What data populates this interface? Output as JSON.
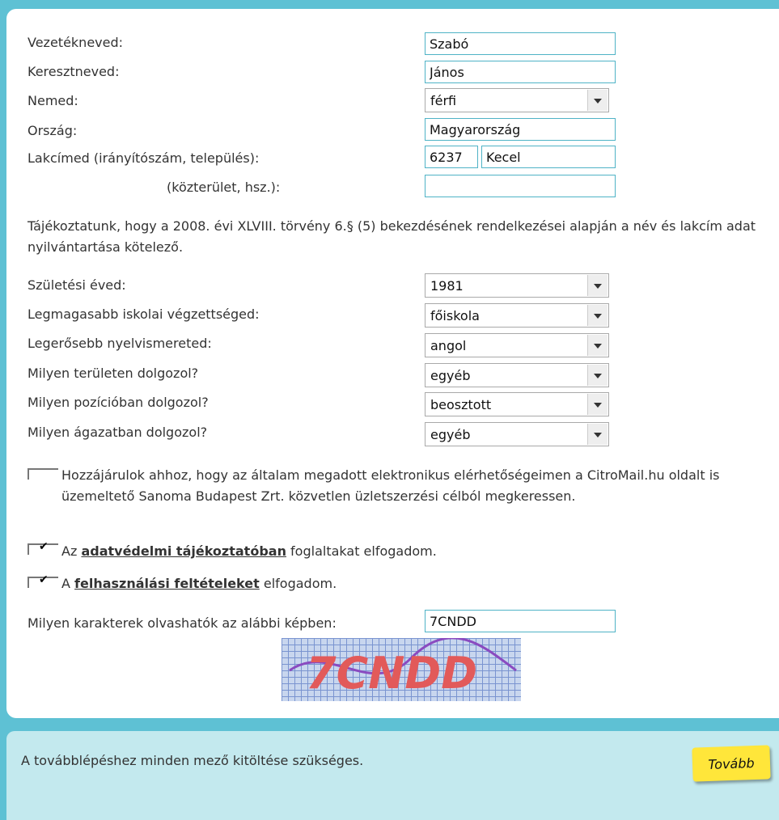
{
  "form": {
    "last_name": {
      "label": "Vezetékneved:",
      "value": "Szabó"
    },
    "first_name": {
      "label": "Keresztneved:",
      "value": "János"
    },
    "gender": {
      "label": "Nemed:",
      "value": "férfi"
    },
    "country": {
      "label": "Ország:",
      "value": "Magyarország"
    },
    "address": {
      "label": "Lakcímed (irányítószám, település):",
      "zip": "6237",
      "city": "Kecel"
    },
    "street": {
      "label": "(közterület, hsz.):",
      "value": ""
    }
  },
  "notice": "Tájékoztatunk, hogy a 2008. évi XLVIII. törvény 6.§ (5) bekezdésének rendelkezései alapján a név és lakcím adat nyilvántartása kötelező.",
  "profile": {
    "birth_year": {
      "label": "Születési éved:",
      "value": "1981"
    },
    "education": {
      "label": "Legmagasabb iskolai végzettséged:",
      "value": "főiskola"
    },
    "language": {
      "label": "Legerősebb nyelvismereted:",
      "value": "angol"
    },
    "field": {
      "label": "Milyen területen dolgozol?",
      "value": "egyéb"
    },
    "position": {
      "label": "Milyen pozícióban dolgozol?",
      "value": "beosztott"
    },
    "sector": {
      "label": "Milyen ágazatban dolgozol?",
      "value": "egyéb"
    }
  },
  "consents": {
    "marketing": {
      "text": "Hozzájárulok ahhoz, hogy az általam megadott elektronikus elérhetőségeimen a CitroMail.hu oldalt is üzemeltető Sanoma Budapest Zrt. közvetlen üzletszerzési célból megkeressen.",
      "checked": false
    },
    "privacy": {
      "pre": "Az",
      "link": "adatvédelmi tájékoztatóban",
      "post": "foglaltakat elfogadom.",
      "checked": true
    },
    "terms": {
      "pre": "A",
      "link": "felhasználási feltételeket",
      "post": "elfogadom.",
      "checked": true
    },
    "check_mark": "✔"
  },
  "captcha": {
    "label": "Milyen karakterek olvashatók az alábbi képben:",
    "value": "7CNDD",
    "image_text": "7CNDD"
  },
  "footer": {
    "message": "A továbblépéshez minden mező kitöltése szükséges.",
    "next_button": "Tovább"
  },
  "colors": {
    "background": "#5ec1d4",
    "footer": "#c3e9ee",
    "button": "#ffe63a",
    "input_border": "#4fb3c6"
  }
}
